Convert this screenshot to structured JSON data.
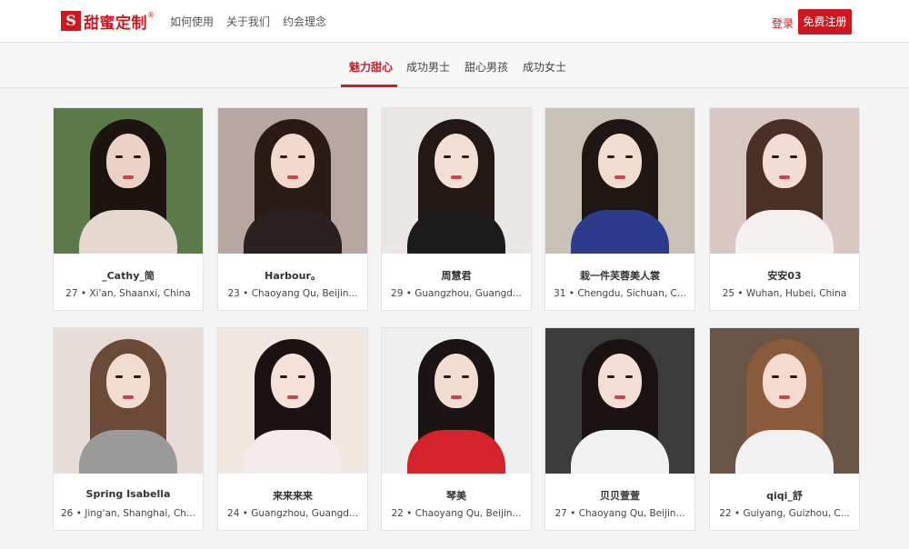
{
  "brand": {
    "mark": "S",
    "name": "甜蜜定制",
    "reg": "®",
    "color": "#d0171f"
  },
  "nav": [
    "如何使用",
    "关于我们",
    "约会理念"
  ],
  "auth": {
    "login": "登录",
    "register": "免费注册"
  },
  "tabs": [
    {
      "label": "魅力甜心",
      "active": true
    },
    {
      "label": "成功男士",
      "active": false
    },
    {
      "label": "甜心男孩",
      "active": false
    },
    {
      "label": "成功女士",
      "active": false
    }
  ],
  "profiles": [
    {
      "name": "_Cathy_简",
      "info": "27 • Xi'an, Shaanxi, China",
      "bg": "#5a7a4a",
      "hair": "#1d1412",
      "skin": "#ead3c6",
      "top": "#e7d8cf"
    },
    {
      "name": "Harbour。",
      "info": "23 • Chaoyang Qu, Beijin...",
      "bg": "#b7a6a2",
      "hair": "#2a1b16",
      "skin": "#f1d9cd",
      "top": "#2b2120"
    },
    {
      "name": "周慧君",
      "info": "29 • Guangzhou, Guangd...",
      "bg": "#e9e6e4",
      "hair": "#231815",
      "skin": "#f4dfd6",
      "top": "#1b1b1b"
    },
    {
      "name": "栽一件芙蓉美人裳",
      "info": "31 • Chengdu, Sichuan, C...",
      "bg": "#c9c0b6",
      "hair": "#1f1714",
      "skin": "#f2dbcf",
      "top": "#2c3b8c"
    },
    {
      "name": "安安03",
      "info": "25 • Wuhan, Hubei, China",
      "bg": "#d9c7c3",
      "hair": "#4a3026",
      "skin": "#f3dcd3",
      "top": "#f4f1ef"
    },
    {
      "name": "Spring Isabella",
      "info": "26 • Jing'an, Shanghai, Ch...",
      "bg": "#e7dcd8",
      "hair": "#6c4a38",
      "skin": "#f2dcd2",
      "top": "#9a9a9a"
    },
    {
      "name": "来来来来",
      "info": "24 • Guangzhou, Guangd...",
      "bg": "#efe7e0",
      "hair": "#1a1311",
      "skin": "#f5e1da",
      "top": "#f2ecea"
    },
    {
      "name": "琴美",
      "info": "22 • Chaoyang Qu, Beijin...",
      "bg": "#efefef",
      "hair": "#1a1412",
      "skin": "#f3ddd3",
      "top": "#d4232b"
    },
    {
      "name": "贝贝萱萱",
      "info": "27 • Chaoyang Qu, Beijin...",
      "bg": "#3b3b3b",
      "hair": "#1b1311",
      "skin": "#f4ddd4",
      "top": "#f1f1f1"
    },
    {
      "name": "qiqi_舒",
      "info": "22 • Guiyang, Guizhou, C...",
      "bg": "#6a5446",
      "hair": "#8a5a3c",
      "skin": "#f3dbd0",
      "top": "#f1f1f1"
    }
  ],
  "accent": "#c8202a"
}
